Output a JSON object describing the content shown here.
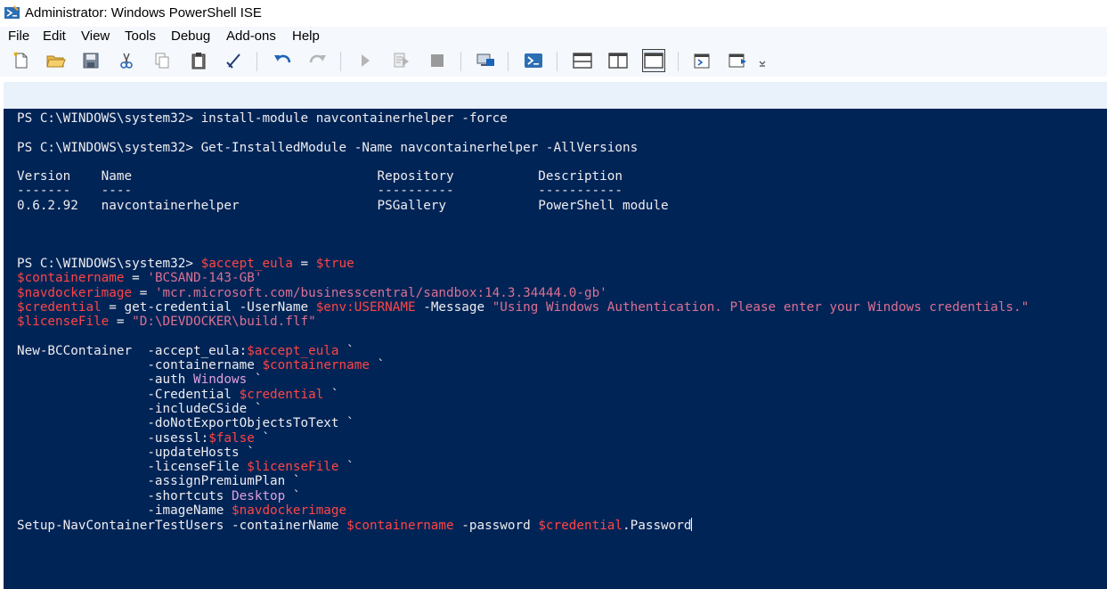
{
  "window": {
    "title": "Administrator: Windows PowerShell ISE"
  },
  "menu": [
    "File",
    "Edit",
    "View",
    "Tools",
    "Debug",
    "Add-ons",
    "Help"
  ],
  "toolbar": {
    "buttons": [
      "new-script",
      "open",
      "save",
      "cut",
      "copy",
      "paste",
      "clear-console",
      "undo",
      "redo",
      "run-script",
      "run-selection",
      "stop",
      "new-remote-tab",
      "start-powershell",
      "show-script-pane-top",
      "show-script-pane-right",
      "show-script-pane-maximized",
      "show-command-window",
      "show-command-addon"
    ]
  },
  "console": {
    "lines": [
      [
        {
          "t": "PS C:\\WINDOWS\\system32> install-module navcontainerhelper -force",
          "c": "c"
        }
      ],
      [],
      [
        {
          "t": "PS C:\\WINDOWS\\system32> Get-InstalledModule -Name navcontainerhelper -AllVersions",
          "c": "c"
        }
      ],
      [],
      [
        {
          "t": "Version    Name                                Repository           Description",
          "c": "c"
        }
      ],
      [
        {
          "t": "-------    ----                                ----------           -----------",
          "c": "c"
        }
      ],
      [
        {
          "t": "0.6.2.92   navcontainerhelper                  PSGallery            PowerShell module",
          "c": "c"
        }
      ],
      [],
      [],
      [],
      [
        {
          "t": "PS C:\\WINDOWS\\system32> ",
          "c": "c"
        },
        {
          "t": "$accept_eula",
          "c": "v"
        },
        {
          "t": " = ",
          "c": "c"
        },
        {
          "t": "$true",
          "c": "v"
        }
      ],
      [
        {
          "t": "$containername",
          "c": "v"
        },
        {
          "t": " = ",
          "c": "c"
        },
        {
          "t": "'BCSAND-143-GB'",
          "c": "s"
        }
      ],
      [
        {
          "t": "$navdockerimage",
          "c": "v"
        },
        {
          "t": " = ",
          "c": "c"
        },
        {
          "t": "'mcr.microsoft.com/businesscentral/sandbox:14.3.34444.0-gb'",
          "c": "s"
        }
      ],
      [
        {
          "t": "$credential",
          "c": "v"
        },
        {
          "t": " = get-credential -UserName ",
          "c": "c"
        },
        {
          "t": "$env:USERNAME",
          "c": "v"
        },
        {
          "t": " -Message ",
          "c": "c"
        },
        {
          "t": "\"Using Windows Authentication. Please enter your Windows credentials.\"",
          "c": "s"
        }
      ],
      [
        {
          "t": "$licenseFile",
          "c": "v"
        },
        {
          "t": " = ",
          "c": "c"
        },
        {
          "t": "\"D:\\DEVDOCKER\\build.flf\"",
          "c": "s"
        }
      ],
      [],
      [
        {
          "t": "New-BCContainer  -accept_eula:",
          "c": "c"
        },
        {
          "t": "$accept_eula",
          "c": "v"
        },
        {
          "t": " `",
          "c": "c"
        }
      ],
      [
        {
          "t": "                 -containername ",
          "c": "c"
        },
        {
          "t": "$containername",
          "c": "v"
        },
        {
          "t": " `",
          "c": "c"
        }
      ],
      [
        {
          "t": "                 -auth ",
          "c": "c"
        },
        {
          "t": "Windows",
          "c": "k"
        },
        {
          "t": " `",
          "c": "c"
        }
      ],
      [
        {
          "t": "                 -Credential ",
          "c": "c"
        },
        {
          "t": "$credential",
          "c": "v"
        },
        {
          "t": " `",
          "c": "c"
        }
      ],
      [
        {
          "t": "                 -includeCSide `",
          "c": "c"
        }
      ],
      [
        {
          "t": "                 -doNotExportObjectsToText `",
          "c": "c"
        }
      ],
      [
        {
          "t": "                 -usessl:",
          "c": "c"
        },
        {
          "t": "$false",
          "c": "v"
        },
        {
          "t": " `",
          "c": "c"
        }
      ],
      [
        {
          "t": "                 -updateHosts `",
          "c": "c"
        }
      ],
      [
        {
          "t": "                 -licenseFile ",
          "c": "c"
        },
        {
          "t": "$licenseFile",
          "c": "v"
        },
        {
          "t": " `",
          "c": "c"
        }
      ],
      [
        {
          "t": "                 -assignPremiumPlan `",
          "c": "c"
        }
      ],
      [
        {
          "t": "                 -shortcuts ",
          "c": "c"
        },
        {
          "t": "Desktop",
          "c": "k"
        },
        {
          "t": " `",
          "c": "c"
        }
      ],
      [
        {
          "t": "                 -imageName ",
          "c": "c"
        },
        {
          "t": "$navdockerimage",
          "c": "v"
        }
      ],
      [
        {
          "t": "Setup-NavContainerTestUsers -containerName ",
          "c": "c"
        },
        {
          "t": "$containername",
          "c": "v"
        },
        {
          "t": " -password ",
          "c": "c"
        },
        {
          "t": "$credential",
          "c": "v"
        },
        {
          "t": ".Password",
          "c": "c"
        }
      ]
    ]
  }
}
